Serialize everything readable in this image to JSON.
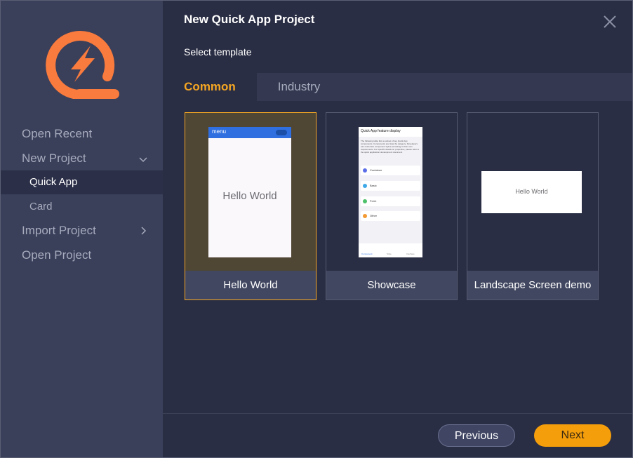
{
  "sidebar": {
    "items": [
      {
        "label": "Open Recent"
      },
      {
        "label": "New Project"
      },
      {
        "label": "Quick App"
      },
      {
        "label": "Card"
      },
      {
        "label": "Import Project"
      },
      {
        "label": "Open Project"
      }
    ]
  },
  "dialog": {
    "title": "New Quick App Project",
    "subtitle": "Select template"
  },
  "tabs": [
    {
      "label": "Common"
    },
    {
      "label": "Industry"
    }
  ],
  "templates": [
    {
      "label": "Hello World",
      "preview": {
        "header": "menu",
        "body": "Hello World"
      }
    },
    {
      "label": "Showcase",
      "preview": {
        "header": "Quick App feature display",
        "intro": "The following table lists a subset of key Quick App components. Components are listed by category. Developers can customize component styles according to their own requirements. For specific details on properties, please refer to the quick application development document",
        "rows": [
          "Container",
          "Basic",
          "Form",
          "Other"
        ],
        "nav": [
          "Component",
          "Style",
          "Interface"
        ]
      }
    },
    {
      "label": "Landscape Screen demo",
      "preview": {
        "body": "Hello World"
      }
    }
  ],
  "footer": {
    "previous_label": "Previous",
    "next_label": "Next"
  },
  "colors": {
    "accent": "#f5a623",
    "sidebar_bg": "#3a3f5a",
    "main_bg": "#2a2e44",
    "logo_orange": "#f97b3d"
  },
  "icons": [
    "quick-app-logo-icon",
    "chevron-down-icon",
    "chevron-right-icon",
    "close-icon"
  ]
}
